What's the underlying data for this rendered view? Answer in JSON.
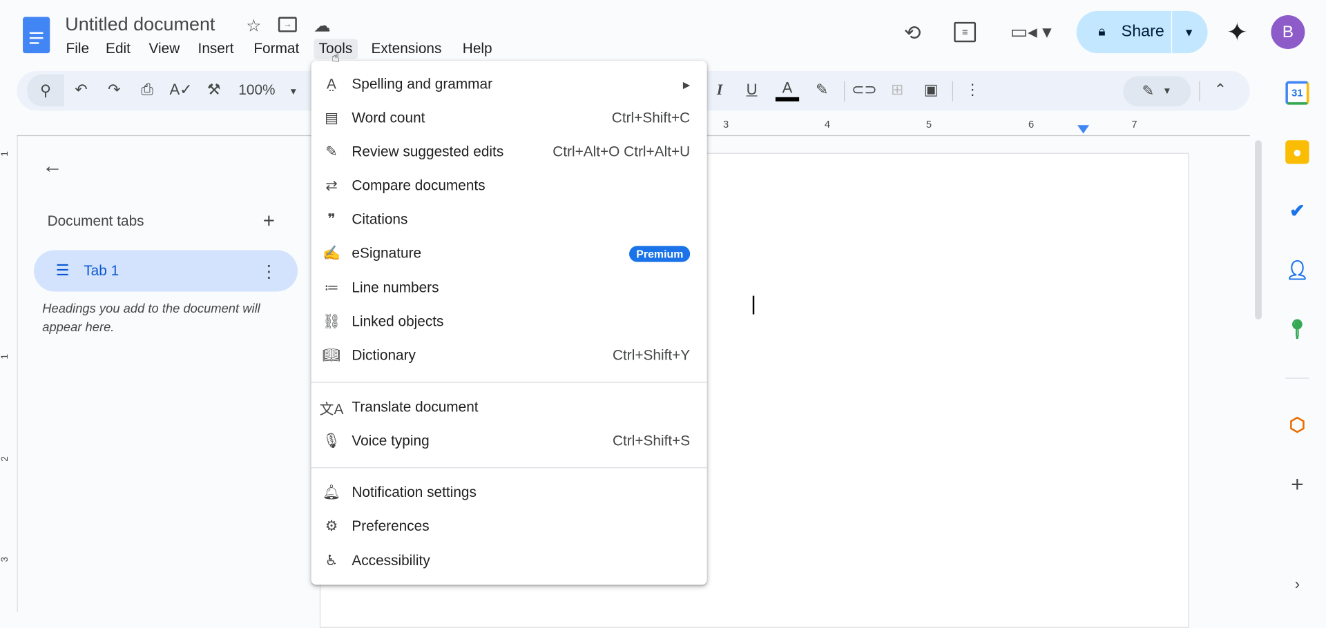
{
  "header": {
    "title": "Untitled document",
    "menus": [
      "File",
      "Edit",
      "View",
      "Insert",
      "Format",
      "Tools",
      "Extensions",
      "Help"
    ],
    "share_label": "Share",
    "avatar_letter": "B"
  },
  "toolbar": {
    "zoom": "100%"
  },
  "ruler": {
    "labels": [
      "3",
      "4",
      "5",
      "6",
      "7"
    ],
    "vertical_labels": [
      "1",
      "1",
      "2",
      "3"
    ]
  },
  "sidebar": {
    "section_title": "Document tabs",
    "tab_label": "Tab 1",
    "hint": "Headings you add to the document will appear here."
  },
  "tools_menu": {
    "items": [
      {
        "label": "Spelling and grammar",
        "icon": "spellcheck-icon",
        "submenu": true
      },
      {
        "label": "Word count",
        "icon": "word-count-icon",
        "shortcut": "Ctrl+Shift+C"
      },
      {
        "label": "Review suggested edits",
        "icon": "review-edits-icon",
        "shortcut": "Ctrl+Alt+O Ctrl+Alt+U"
      },
      {
        "label": "Compare documents",
        "icon": "compare-icon"
      },
      {
        "label": "Citations",
        "icon": "quote-icon"
      },
      {
        "label": "eSignature",
        "icon": "signature-icon",
        "badge": "Premium"
      },
      {
        "label": "Line numbers",
        "icon": "line-numbers-icon"
      },
      {
        "label": "Linked objects",
        "icon": "linked-objects-icon"
      },
      {
        "label": "Dictionary",
        "icon": "dictionary-icon",
        "shortcut": "Ctrl+Shift+Y"
      },
      {
        "label": "Translate document",
        "icon": "translate-icon"
      },
      {
        "label": "Voice typing",
        "icon": "microphone-icon",
        "shortcut": "Ctrl+Shift+S"
      },
      {
        "label": "Notification settings",
        "icon": "bell-icon"
      },
      {
        "label": "Preferences",
        "icon": "preferences-icon"
      },
      {
        "label": "Accessibility",
        "icon": "accessibility-icon"
      }
    ]
  },
  "colors": {
    "accent": "#1a73e8",
    "share_bg": "#c2e7ff",
    "tab_bg": "#d3e3fd",
    "avatar": "#8e5cc9"
  }
}
